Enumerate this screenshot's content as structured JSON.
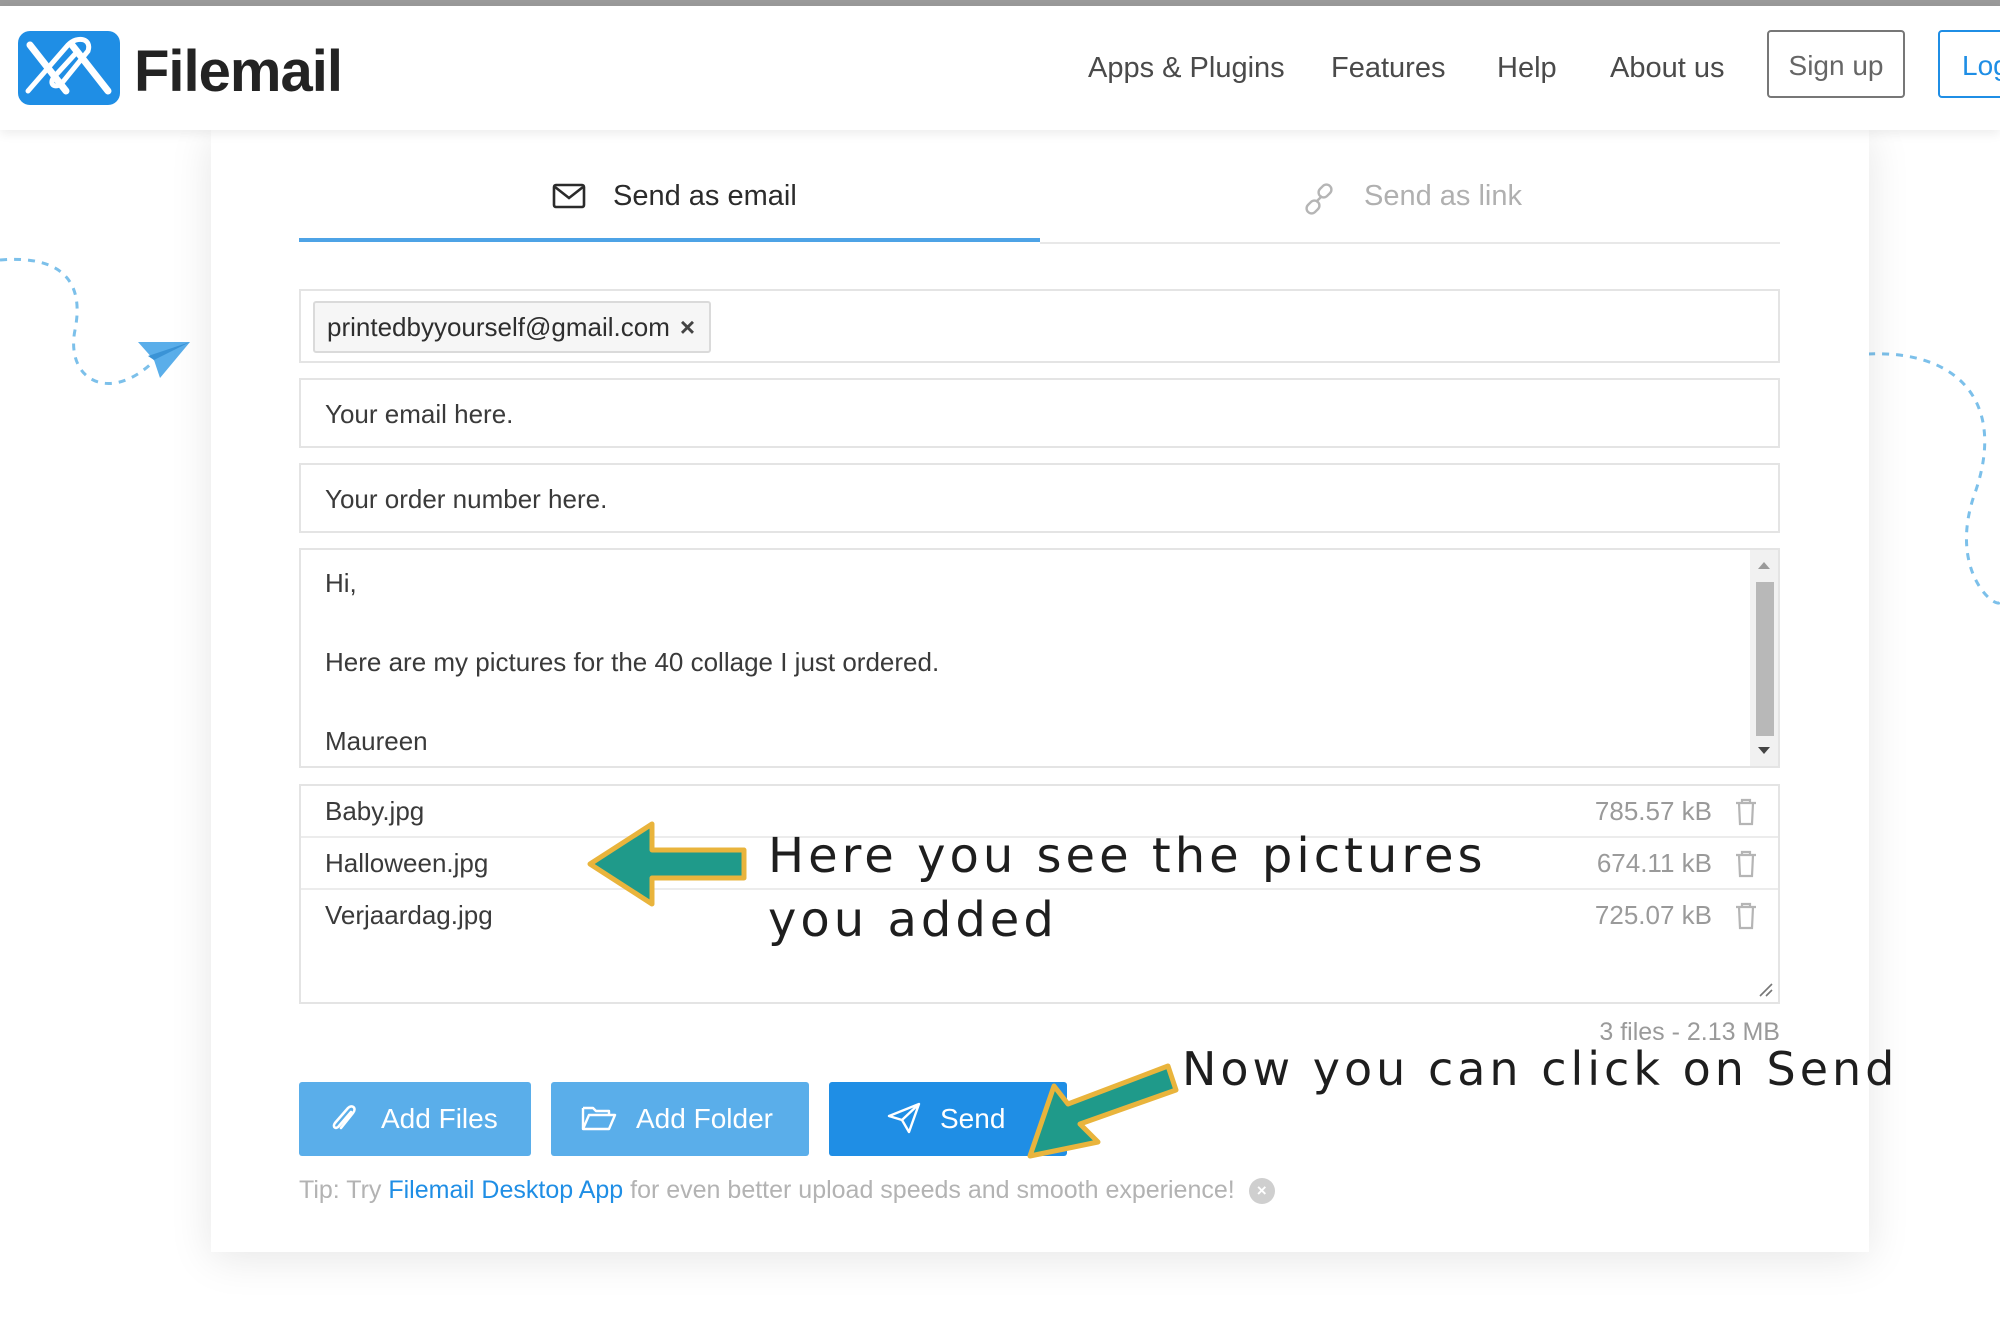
{
  "header": {
    "logo_text": "Filemail",
    "nav": [
      "Apps & Plugins",
      "Features",
      "Help",
      "About us"
    ],
    "signup_label": "Sign up",
    "login_label": "Log"
  },
  "tabs": {
    "email_label": "Send as email",
    "link_label": "Send as link"
  },
  "form": {
    "recipient_chip": "printedbyyourself@gmail.com",
    "chip_remove": "×",
    "sender_email": "Your email here.",
    "order_number": "Your order number here.",
    "message_lines": [
      "Hi,",
      "Here are my pictures for the 40 collage I just ordered.",
      "Maureen"
    ]
  },
  "files": [
    {
      "name": "Baby.jpg",
      "size": "785.57 kB"
    },
    {
      "name": "Halloween.jpg",
      "size": "674.11 kB"
    },
    {
      "name": "Verjaardag.jpg",
      "size": "725.07 kB"
    }
  ],
  "summary": "3 files - 2.13 MB",
  "actions": {
    "add_files": "Add Files",
    "add_folder": "Add Folder",
    "send": "Send"
  },
  "tip": {
    "prefix": "Tip: Try ",
    "link": "Filemail Desktop App",
    "suffix": " for even better upload speeds and smooth experience!"
  },
  "annotations": {
    "pictures_line1": "Here you see the pictures",
    "pictures_line2": "you added",
    "send_note": "Now you can click on Send"
  },
  "colors": {
    "brand_blue": "#1f8ee5",
    "light_button": "#5aaeea",
    "send_button": "#1f8ee5",
    "arrow_fill": "#1f9a8a",
    "arrow_border": "#e9b43c"
  }
}
